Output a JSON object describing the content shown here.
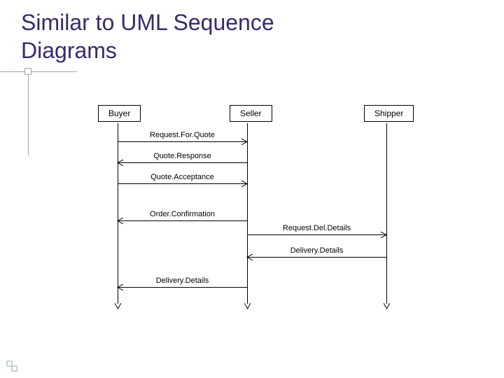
{
  "title_line1": "Similar to UML Sequence",
  "title_line2": "Diagrams",
  "actors": {
    "buyer": "Buyer",
    "seller": "Seller",
    "shipper": "Shipper"
  },
  "messages": {
    "m1": "Request.For.Quote",
    "m2": "Quote.Response",
    "m3": "Quote.Acceptance",
    "m4": "Order.Confirmation",
    "m5": "Request.Del.Details",
    "m6": "Delivery.Details",
    "m7": "Delivery.Details"
  }
}
